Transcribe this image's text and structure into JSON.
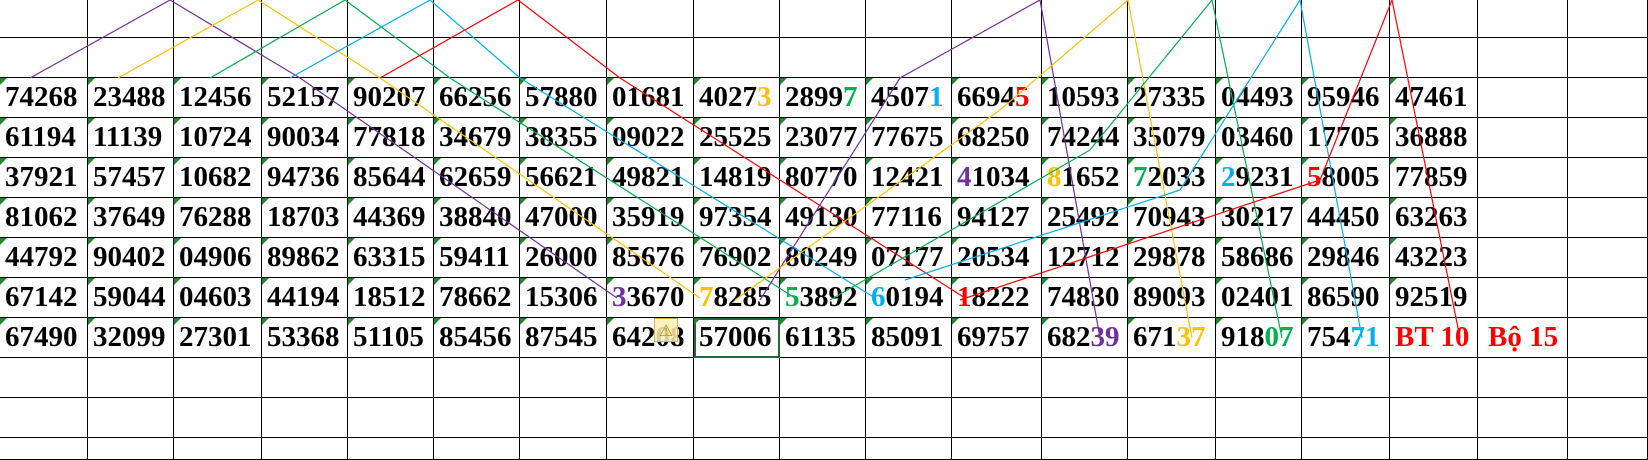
{
  "spreadsheet": {
    "rows": [
      [
        "74268",
        "23488",
        "12456",
        "52157",
        "90207",
        "66256",
        "57880",
        "01681",
        "40273",
        "28997",
        "45071",
        "66945",
        "10593",
        "27335",
        "04493",
        "95946",
        "47461"
      ],
      [
        "61194",
        "11139",
        "10724",
        "90034",
        "77818",
        "34679",
        "38355",
        "09022",
        "25525",
        "23077",
        "77675",
        "68250",
        "74244",
        "35079",
        "03460",
        "17705",
        "36888"
      ],
      [
        "37921",
        "57457",
        "10682",
        "94736",
        "85644",
        "62659",
        "56621",
        "49821",
        "14819",
        "80770",
        "12421",
        "41034",
        "81652",
        "72033",
        "29231",
        "58005",
        "77859"
      ],
      [
        "81062",
        "37649",
        "76288",
        "18703",
        "44369",
        "38840",
        "47000",
        "35919",
        "97354",
        "49130",
        "77116",
        "94127",
        "25492",
        "70943",
        "30217",
        "44450",
        "63263"
      ],
      [
        "44792",
        "90402",
        "04906",
        "89862",
        "63315",
        "59411",
        "26000",
        "85676",
        "76902",
        "80249",
        "07177",
        "20534",
        "12712",
        "29878",
        "58686",
        "29846",
        "43223"
      ],
      [
        "67142",
        "59044",
        "04603",
        "44194",
        "18512",
        "78662",
        "15306",
        "33670",
        "78285",
        "53892",
        "60194",
        "18222",
        "74830",
        "89093",
        "02401",
        "86590",
        "92519"
      ],
      [
        "67490",
        "32099",
        "27301",
        "53368",
        "51105",
        "85456",
        "87545",
        "64208",
        "57006",
        "61135",
        "85091",
        "69757",
        "68239",
        "67137",
        "91807",
        "75471",
        "BT 10",
        "Bộ 15"
      ]
    ],
    "highlights": [
      {
        "row": 0,
        "col": 8,
        "start": 4,
        "end": 5,
        "color": "#ffc000"
      },
      {
        "row": 0,
        "col": 9,
        "start": 4,
        "end": 5,
        "color": "#00b050"
      },
      {
        "row": 0,
        "col": 10,
        "start": 4,
        "end": 5,
        "color": "#00b0f0"
      },
      {
        "row": 0,
        "col": 11,
        "start": 4,
        "end": 5,
        "color": "#ff0000"
      },
      {
        "row": 2,
        "col": 11,
        "start": 0,
        "end": 1,
        "color": "#7030a0"
      },
      {
        "row": 2,
        "col": 12,
        "start": 0,
        "end": 1,
        "color": "#ffc000"
      },
      {
        "row": 2,
        "col": 13,
        "start": 0,
        "end": 1,
        "color": "#00b050"
      },
      {
        "row": 2,
        "col": 14,
        "start": 0,
        "end": 1,
        "color": "#00b0f0"
      },
      {
        "row": 2,
        "col": 15,
        "start": 0,
        "end": 1,
        "color": "#ff0000"
      },
      {
        "row": 5,
        "col": 7,
        "start": 0,
        "end": 1,
        "color": "#7030a0"
      },
      {
        "row": 5,
        "col": 8,
        "start": 0,
        "end": 1,
        "color": "#ffc000"
      },
      {
        "row": 5,
        "col": 9,
        "start": 0,
        "end": 1,
        "color": "#00b050"
      },
      {
        "row": 5,
        "col": 10,
        "start": 0,
        "end": 1,
        "color": "#00b0f0"
      },
      {
        "row": 5,
        "col": 11,
        "start": 0,
        "end": 1,
        "color": "#ff0000"
      },
      {
        "row": 6,
        "col": 12,
        "start": 3,
        "end": 5,
        "color": "#7030a0"
      },
      {
        "row": 6,
        "col": 13,
        "start": 3,
        "end": 5,
        "color": "#ffc000"
      },
      {
        "row": 6,
        "col": 14,
        "start": 3,
        "end": 5,
        "color": "#00b050"
      },
      {
        "row": 6,
        "col": 15,
        "start": 3,
        "end": 5,
        "color": "#00b0f0"
      },
      {
        "row": 6,
        "col": 16,
        "start": 0,
        "end": 5,
        "color": "#ff0000"
      },
      {
        "row": 6,
        "col": 17,
        "start": 0,
        "end": 5,
        "color": "#ff0000"
      }
    ],
    "selected_cell": {
      "row": 6,
      "col": 8
    },
    "warning_icon": "warning-icon",
    "line_colors": [
      "#7030a0",
      "#ffc000",
      "#00b050",
      "#00b0f0",
      "#ff0000"
    ]
  }
}
